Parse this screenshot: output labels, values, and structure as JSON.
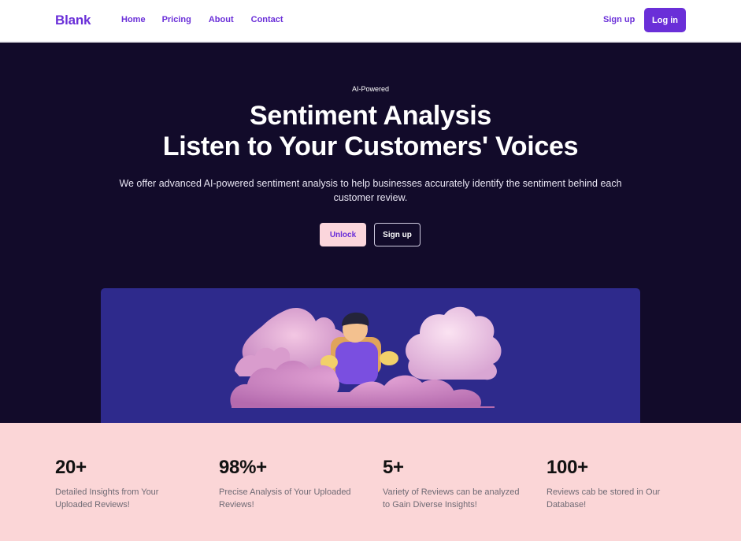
{
  "nav": {
    "logo": "Blank",
    "links": [
      "Home",
      "Pricing",
      "About",
      "Contact"
    ],
    "signup": "Sign up",
    "login": "Log in"
  },
  "hero": {
    "eyebrow": "AI-Powered",
    "title_line1": "Sentiment Analysis",
    "title_line2": "Listen to Your Customers' Voices",
    "subtitle": "We offer advanced AI-powered sentiment analysis to help businesses accurately identify the sentiment behind each customer review.",
    "primary_button": "Unlock",
    "secondary_button": "Sign up",
    "illustration": "person-between-clouds-illustration"
  },
  "stats": [
    {
      "value": "20+",
      "desc": "Detailed Insights from Your Uploaded Reviews!"
    },
    {
      "value": "98%+",
      "desc": "Precise Analysis of Your Uploaded Reviews!"
    },
    {
      "value": "5+",
      "desc": "Variety of Reviews can be analyzed to Gain Diverse Insights!"
    },
    {
      "value": "100+",
      "desc": "Reviews cab be stored in Our Database!"
    }
  ],
  "colors": {
    "brand": "#6a2fd8",
    "hero_bg": "#120b2a",
    "panel_bg": "#2e2a8c",
    "stats_bg": "#fbd6d7",
    "unlock_bg": "#fbd6dc"
  }
}
